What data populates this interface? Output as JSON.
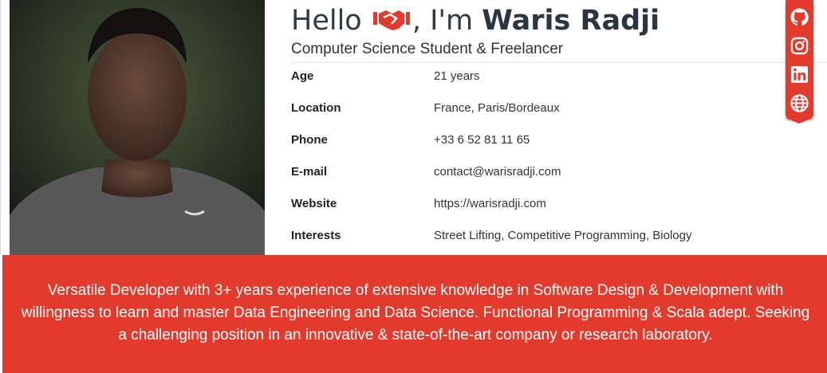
{
  "hero": {
    "hello": "Hello",
    "im": ", I'm",
    "name": "Waris Radji",
    "subtitle": "Computer Science Student & Freelancer"
  },
  "colors": {
    "accent": "#e23b2e",
    "heading": "#2f3a45"
  },
  "info": [
    {
      "label": "Age",
      "value": "21 years"
    },
    {
      "label": "Location",
      "value": "France, Paris/Bordeaux"
    },
    {
      "label": "Phone",
      "value": "+33 6 52 81 11 65"
    },
    {
      "label": "E-mail",
      "value": "contact@warisradji.com"
    },
    {
      "label": "Website",
      "value": "https://warisradji.com"
    },
    {
      "label": "Interests",
      "value": "Street Lifting, Competitive Programming, Biology"
    }
  ],
  "socials": [
    "github-icon",
    "instagram-icon",
    "linkedin-icon",
    "globe-icon"
  ],
  "summary": "Versatile Developer with 3+ years experience of extensive knowledge in Software Design & Development with willingness to learn and master Data Engineering and Data Science. Functional Programming & Scala adept. Seeking a challenging position in an innovative & state-of-the-art company or research laboratory."
}
